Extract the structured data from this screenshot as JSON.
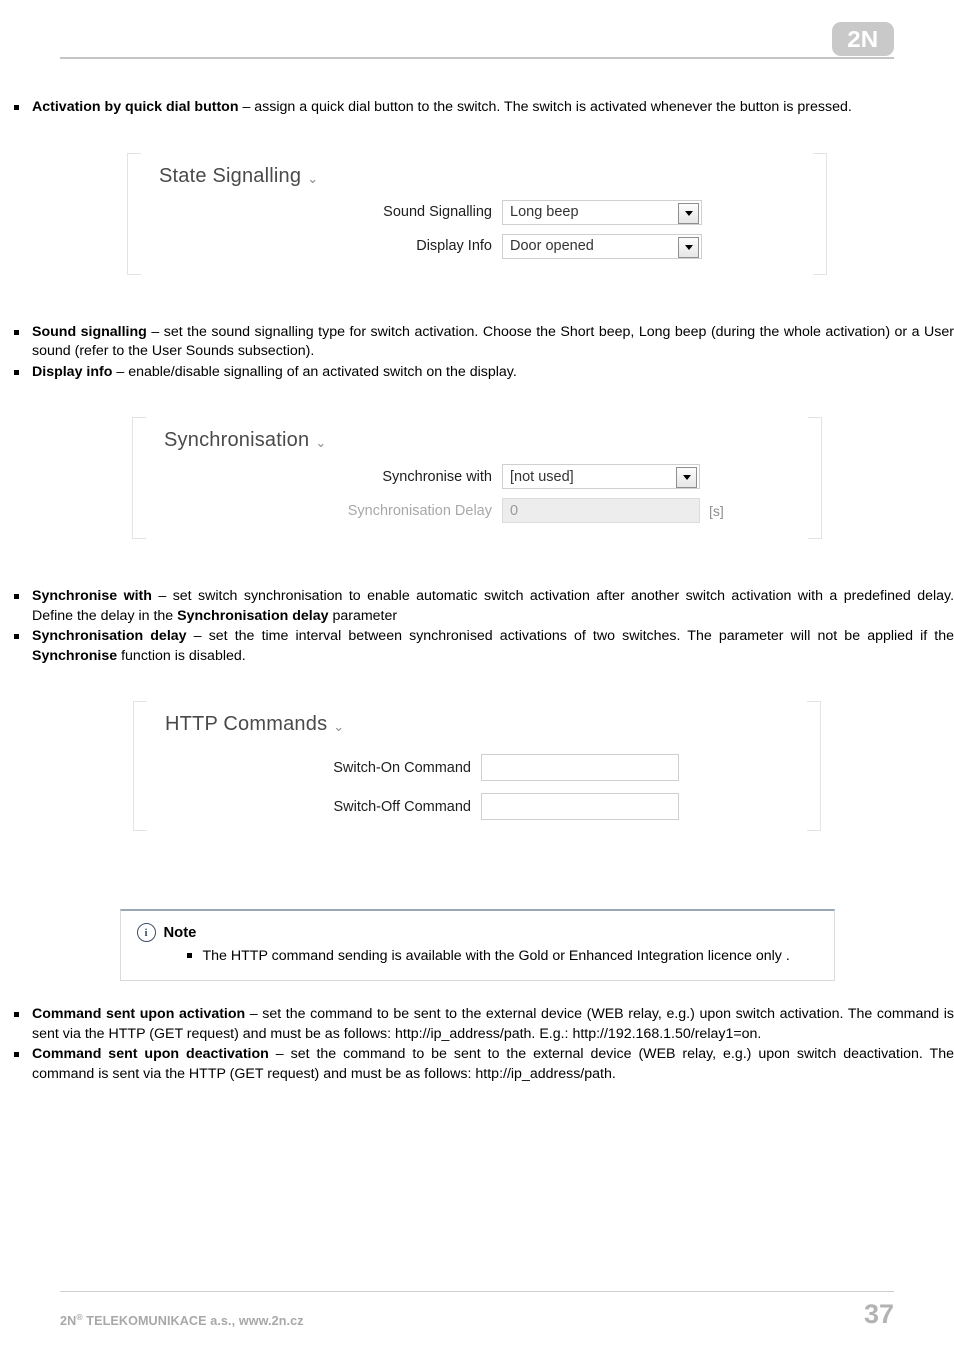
{
  "header": {
    "logo_text": "2N"
  },
  "intro_bullets": [
    {
      "term": "Activation by quick dial button",
      "dash": " – ",
      "text": "assign a quick dial button to the switch. The switch is activated whenever the button is pressed."
    }
  ],
  "state_signalling_panel": {
    "title": "State Signalling",
    "chevron": "⌄",
    "rows": [
      {
        "label": "Sound Signalling",
        "value": "Long beep",
        "type": "dropdown",
        "disabled": false,
        "unit": ""
      },
      {
        "label": "Display Info",
        "value": "Door opened",
        "type": "dropdown",
        "disabled": false,
        "unit": ""
      }
    ]
  },
  "state_signalling_bullets": [
    {
      "term": "Sound signalling",
      "dash": " – ",
      "text": "set the sound signalling type for switch activation. Choose the Short beep, Long beep (during the whole activation) or a User sound (refer to the User Sounds subsection)."
    },
    {
      "term": "Display info",
      "dash": " – ",
      "text": "enable/disable signalling of an activated switch on the display."
    }
  ],
  "synchronisation_panel": {
    "title": "Synchronisation",
    "chevron": "⌄",
    "rows": [
      {
        "label": "Synchronise with",
        "value": "[not used]",
        "type": "dropdown",
        "disabled": false,
        "unit": ""
      },
      {
        "label": "Synchronisation Delay",
        "value": "0",
        "type": "text",
        "disabled": true,
        "unit": "[s]"
      }
    ]
  },
  "synchronisation_bullets": [
    {
      "term": "Synchronise with",
      "dash": " – ",
      "text_1": "set switch synchronisation to enable automatic switch activation after another switch activation with a predefined delay. Define the delay in the ",
      "emphasis": "Synchronisation delay",
      "text_2": " parameter"
    },
    {
      "term": "Synchronisation delay",
      "dash": " – ",
      "text_1": "set the time interval between synchronised activations of two switches. The parameter will not be applied if the ",
      "emphasis": "Synchronise",
      "text_2": " function is disabled."
    }
  ],
  "http_commands_panel": {
    "title": "HTTP Commands",
    "chevron": "⌄",
    "rows": [
      {
        "label": "Switch-On Command",
        "value": "",
        "type": "text",
        "disabled": false,
        "unit": ""
      },
      {
        "label": "Switch-Off Command",
        "value": "",
        "type": "text",
        "disabled": false,
        "unit": ""
      }
    ]
  },
  "note": {
    "icon": "info-icon",
    "title": "Note",
    "items": [
      "The HTTP command sending is available with the Gold or Enhanced Integration licence only ."
    ]
  },
  "http_bullets": [
    {
      "term": "Command sent upon activation",
      "dash": " – ",
      "text": "set the command to be sent to the external device (WEB relay, e.g.) upon switch activation. The command is sent via the HTTP (GET request) and must be as follows: http://ip_address/path. E.g.: http://192.168.1.50/relay1=on."
    },
    {
      "term": "Command sent upon deactivation",
      "dash": " – ",
      "text": "set the command to be sent to the external device (WEB relay, e.g.) upon switch deactivation. The command is sent via the HTTP (GET request) and must be as follows: http://ip_address/path."
    }
  ],
  "footer": {
    "company_prefix": "2N",
    "company_sup": "®",
    "company_rest": " TELEKOMUNIKACE a.s., www.2n.cz",
    "page_number": "37"
  }
}
